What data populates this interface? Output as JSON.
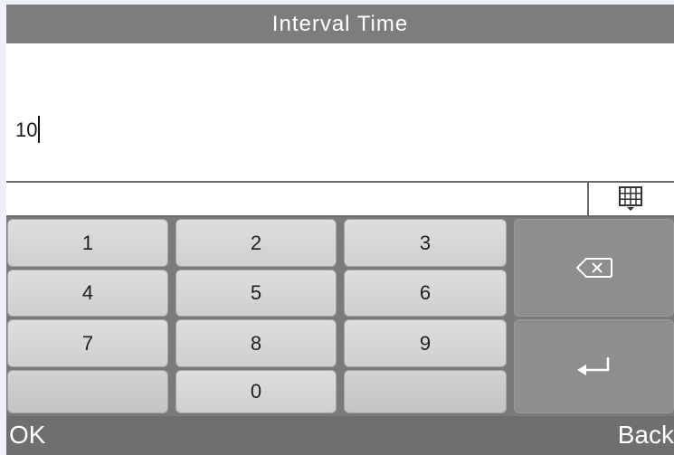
{
  "title": "Interval Time",
  "input": {
    "value": "10"
  },
  "keypad": {
    "keys": [
      "1",
      "2",
      "3",
      "4",
      "5",
      "6",
      "7",
      "8",
      "9",
      "",
      "0",
      ""
    ],
    "backspace_icon": "backspace-icon",
    "enter_icon": "enter-icon",
    "keyboard_toggle_icon": "keyboard-grid-icon"
  },
  "softkeys": {
    "left": "OK",
    "right": "Back"
  },
  "colors": {
    "title_bar": "#7d7d7d",
    "key_face": "#d8d8d8",
    "function_key": "#8e8e8e",
    "bottom_bar": "#6f6f6f"
  }
}
